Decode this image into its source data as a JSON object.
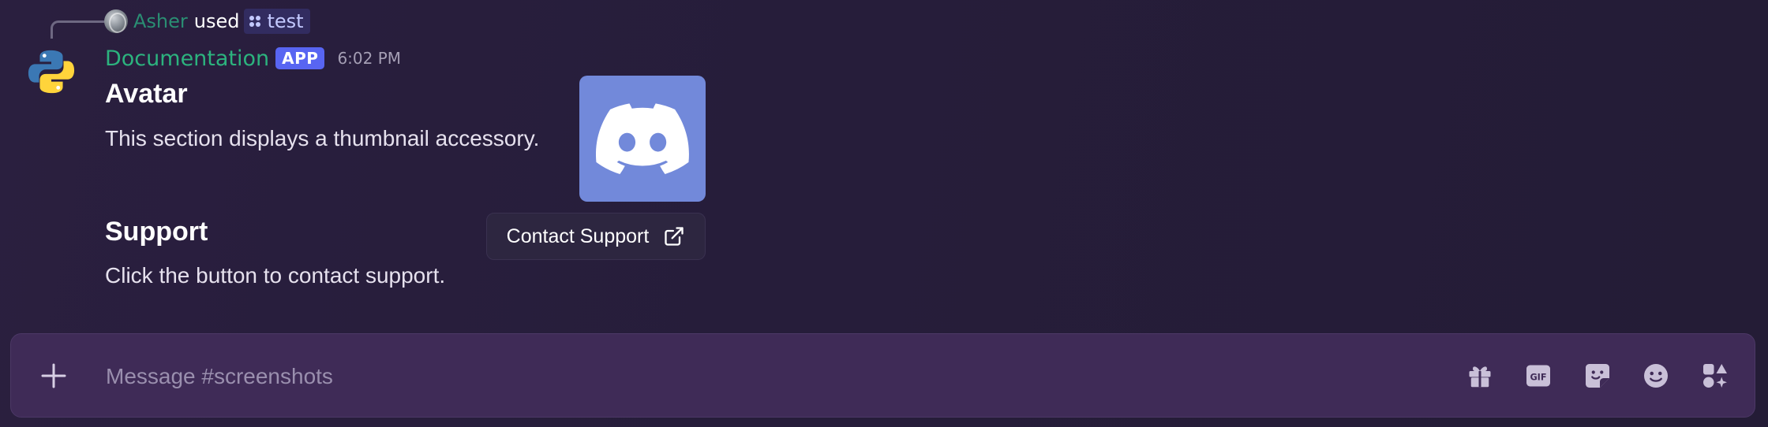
{
  "reply": {
    "user": "Asher",
    "used_text": "used",
    "command": "test"
  },
  "message": {
    "author": "Documentation",
    "badge": "APP",
    "timestamp": "6:02 PM",
    "sections": [
      {
        "title": "Avatar",
        "text": "This section displays a thumbnail accessory."
      },
      {
        "title": "Support",
        "text": "Click the button to contact support."
      }
    ],
    "button_label": "Contact Support",
    "thumbnail_color": "#7289da"
  },
  "composer": {
    "placeholder": "Message #screenshots",
    "value": "",
    "tools": [
      "gift-icon",
      "gif-icon",
      "sticker-icon",
      "emoji-icon",
      "apps-icon"
    ]
  },
  "colors": {
    "background": "#2a1f3f",
    "author": "#2cb37e",
    "reply_user": "#2a8e73",
    "badge": "#5865f2",
    "composer": "#3f2b57"
  }
}
